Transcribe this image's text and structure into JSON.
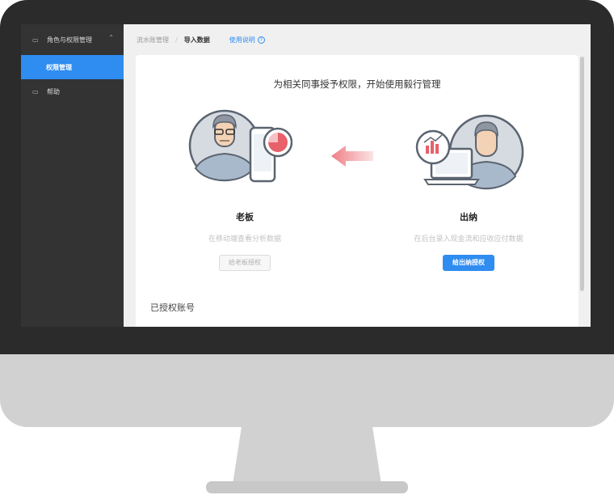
{
  "sidebar": {
    "group_label": "角色与权限管理",
    "active_item": "权限管理",
    "help_label": "帮助"
  },
  "breadcrumb": {
    "parent": "流水账管理",
    "separator": "/",
    "current": "导入数据",
    "help_link": "使用说明",
    "help_icon": "?"
  },
  "main": {
    "headline": "为相关同事授予权限，开始使用毅行管理",
    "boss": {
      "title": "老板",
      "description": "在移动端查看分析数据",
      "button": "给老板授权"
    },
    "cashier": {
      "title": "出纳",
      "description": "在后台录入现金流和应收应付数据",
      "button": "给出纳授权"
    },
    "authorized_section": "已授权账号"
  },
  "colors": {
    "accent": "#2f8cf0",
    "sidebar_bg": "#333333",
    "arrow": "#f28b8b"
  },
  "icons": {
    "menu_monitor": "monitor-icon",
    "collapse": "chevron-up-icon",
    "help": "question-circle-icon"
  }
}
